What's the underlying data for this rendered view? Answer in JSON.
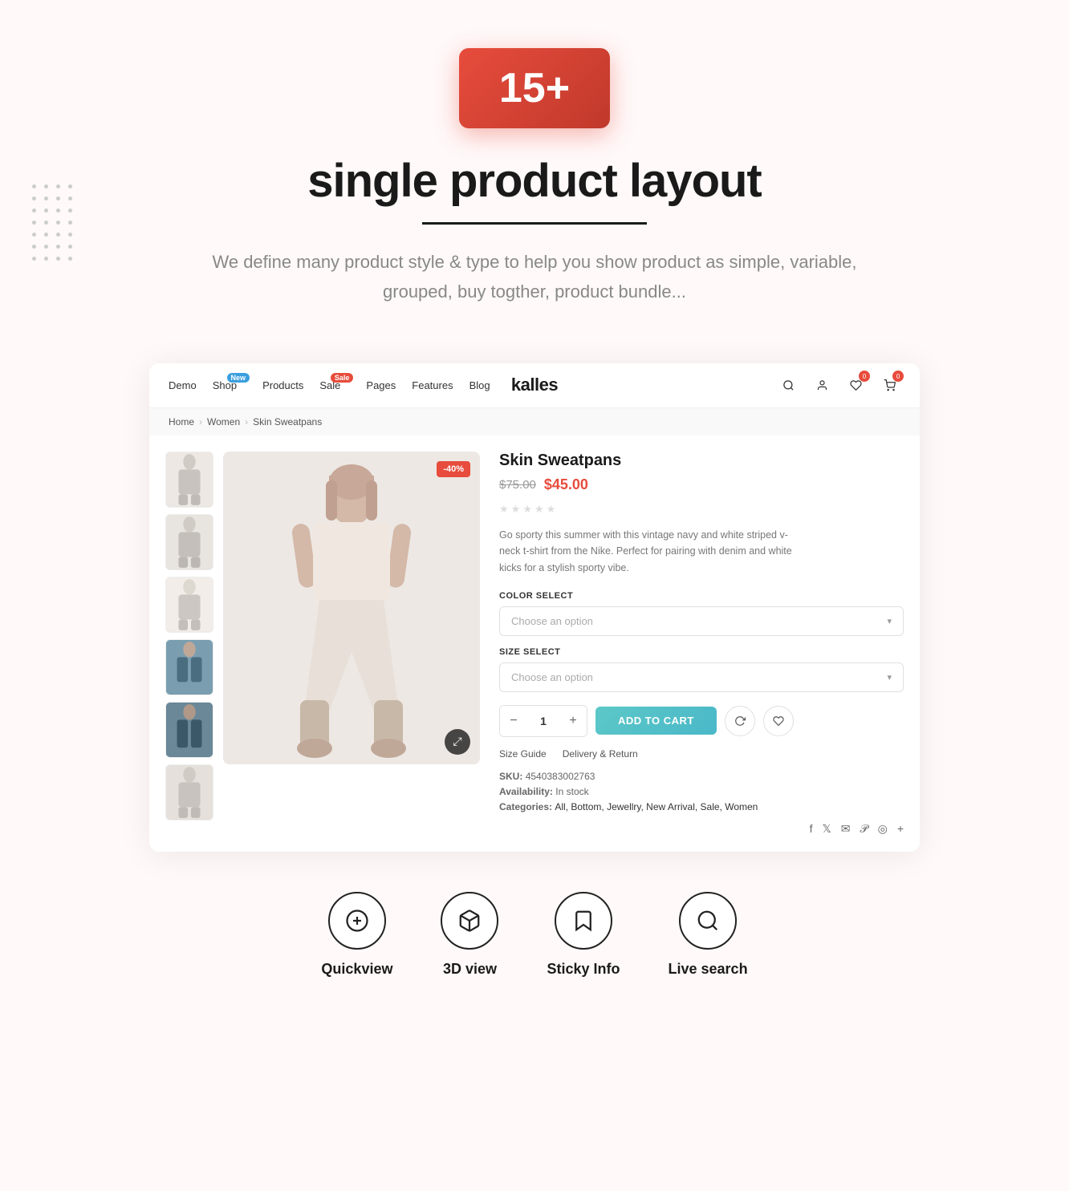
{
  "hero": {
    "badge": "15+",
    "title": "single product layout",
    "description": "We define many product style & type to help you show product as simple, variable, grouped, buy togther, product bundle..."
  },
  "nav": {
    "links": [
      {
        "label": "Demo",
        "badge": null
      },
      {
        "label": "Shop",
        "badge": "New",
        "badge_type": "new"
      },
      {
        "label": "Products",
        "badge": null
      },
      {
        "label": "Sale",
        "badge": "Sale",
        "badge_type": "sale"
      },
      {
        "label": "Pages",
        "badge": null
      },
      {
        "label": "Features",
        "badge": null
      },
      {
        "label": "Blog",
        "badge": null
      }
    ],
    "logo": "kalles",
    "wishlist_count": "0",
    "cart_count": "0"
  },
  "breadcrumb": {
    "items": [
      "Home",
      "Women",
      "Skin Sweatpans"
    ]
  },
  "product": {
    "name": "Skin Sweatpans",
    "price_old": "$75.00",
    "price_new": "$45.00",
    "discount": "-40%",
    "description": "Go sporty this summer with this vintage navy and white striped v-neck t-shirt from the Nike. Perfect for pairing with denim and white kicks for a stylish sporty vibe.",
    "color_select_label": "COLOR SELECT",
    "color_placeholder": "Choose an option",
    "size_select_label": "SIZE SELECT",
    "size_placeholder": "Choose an option",
    "quantity": "1",
    "add_to_cart_label": "ADD TO CART",
    "size_guide_label": "Size Guide",
    "delivery_return_label": "Delivery & Return",
    "sku_label": "SKU:",
    "sku_value": "4540383002763",
    "availability_label": "Availability:",
    "availability_value": "In stock",
    "categories_label": "Categories:",
    "categories": "All, Bottom, Jewellry, New Arrival, Sale, Women"
  },
  "features": [
    {
      "icon": "plus-circle",
      "label": "Quickview"
    },
    {
      "icon": "box-3d",
      "label": "3D view"
    },
    {
      "icon": "bookmark",
      "label": "Sticky Info"
    },
    {
      "icon": "search",
      "label": "Live search"
    }
  ]
}
